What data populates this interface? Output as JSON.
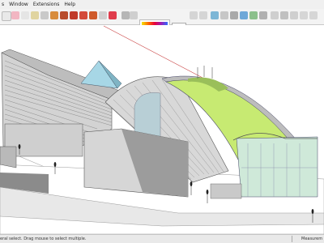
{
  "menu": {
    "items": [
      "s",
      "Window",
      "Extensions",
      "Help"
    ]
  },
  "status": {
    "text": "eral select. Drag mouse to select multiple.",
    "measurements_label": "Measurem"
  },
  "colors": {
    "roof_green": "#c7ea72",
    "wall_grey": "#cfcfcf",
    "glass_green": "#bfe6cf",
    "sky_white": "#ffffff"
  }
}
